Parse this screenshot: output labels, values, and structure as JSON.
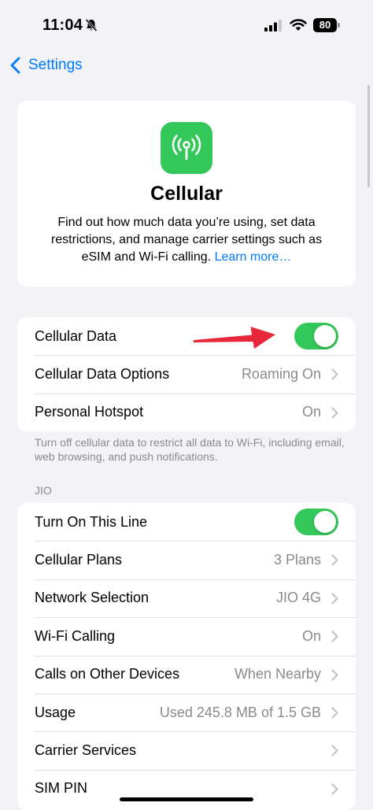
{
  "status_bar": {
    "time": "11:04",
    "battery": "80",
    "icons": [
      "bell-slash-icon",
      "cellular-signal-icon",
      "wifi-icon",
      "battery-icon"
    ]
  },
  "nav": {
    "back_label": "Settings"
  },
  "hero": {
    "icon": "antenna-icon",
    "title": "Cellular",
    "description": "Find out how much data you’re using, set data restrictions, and manage carrier settings such as eSIM and Wi-Fi calling.",
    "link": "Learn more…"
  },
  "group1": {
    "rows": [
      {
        "label": "Cellular Data",
        "toggle": true
      },
      {
        "label": "Cellular Data Options",
        "value": "Roaming On"
      },
      {
        "label": "Personal Hotspot",
        "value": "On"
      }
    ],
    "footnote": "Turn off cellular data to restrict all data to Wi-Fi, including email, web browsing, and push notifications."
  },
  "group2": {
    "header": "JIO",
    "rows": [
      {
        "label": "Turn On This Line",
        "toggle": true
      },
      {
        "label": "Cellular Plans",
        "value": "3 Plans"
      },
      {
        "label": "Network Selection",
        "value": "JIO 4G"
      },
      {
        "label": "Wi-Fi Calling",
        "value": "On"
      },
      {
        "label": "Calls on Other Devices",
        "value": "When Nearby"
      },
      {
        "label": "Usage",
        "value": "Used 245.8 MB of 1.5 GB"
      },
      {
        "label": "Carrier Services",
        "value": ""
      },
      {
        "label": "SIM PIN",
        "value": ""
      }
    ]
  },
  "colors": {
    "accent": "#007aff",
    "toggle_on": "#34c759",
    "annotation_arrow": "#e8283a",
    "background": "#f2f2f7"
  }
}
